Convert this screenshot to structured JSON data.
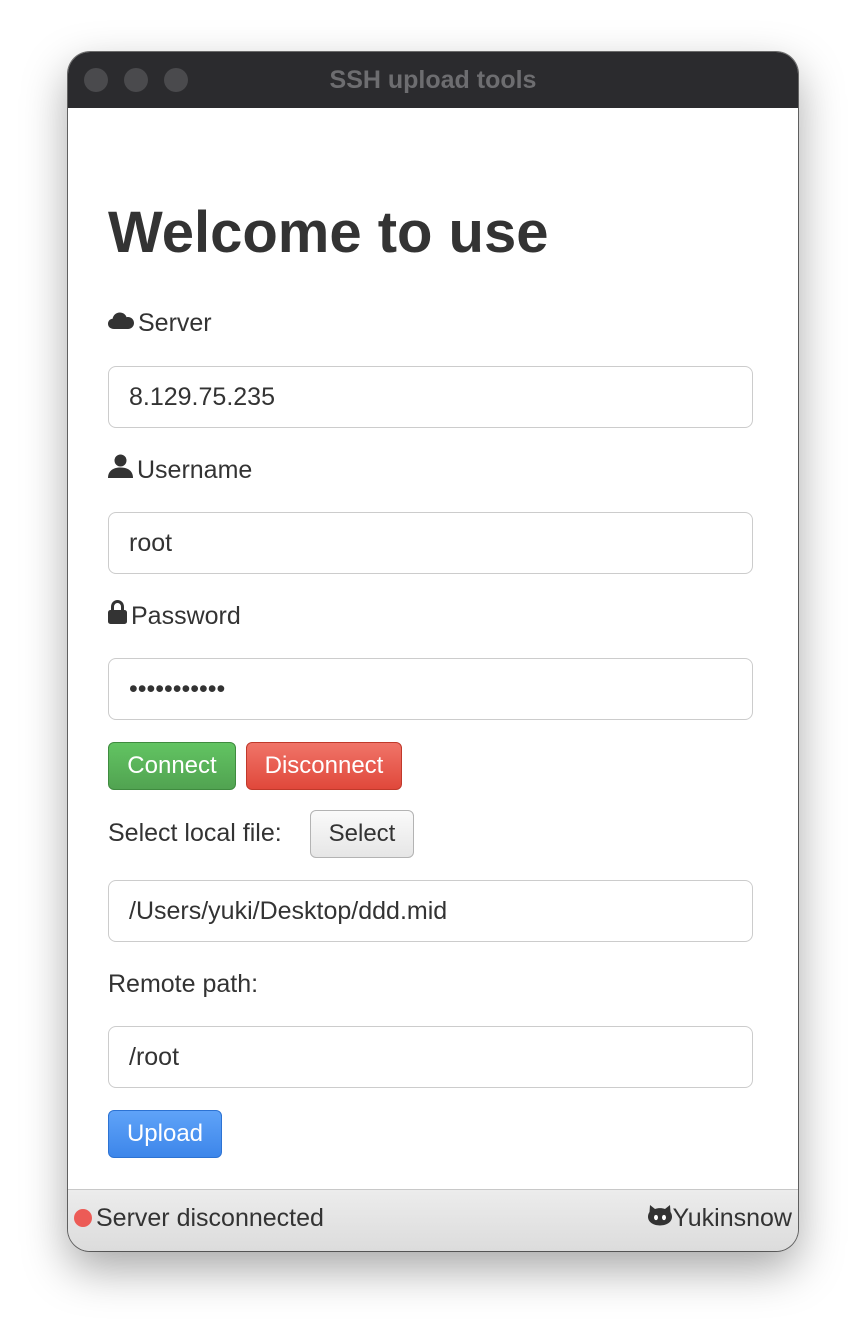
{
  "window": {
    "title": "SSH upload tools"
  },
  "main": {
    "heading": "Welcome to use",
    "server": {
      "label": "Server",
      "icon": "cloud-icon",
      "value": "8.129.75.235"
    },
    "username": {
      "label": "Username",
      "icon": "user-icon",
      "value": "root"
    },
    "password": {
      "label": "Password",
      "icon": "lock-icon",
      "value": "•••••••••••"
    },
    "buttons": {
      "connect": "Connect",
      "disconnect": "Disconnect",
      "select": "Select",
      "upload": "Upload"
    },
    "local_file": {
      "label": "Select local file:",
      "value": "/Users/yuki/Desktop/ddd.mid"
    },
    "remote_path": {
      "label": "Remote path:",
      "value": "/root"
    }
  },
  "statusbar": {
    "status_text": "Server disconnected",
    "status_color": "#ec5b56",
    "author": "Yukinsnow",
    "author_icon": "github-icon"
  },
  "colors": {
    "connect": "#5cb85c",
    "disconnect": "#e74c3c",
    "upload": "#3d86ea",
    "titlebar": "#2b2b2e"
  }
}
